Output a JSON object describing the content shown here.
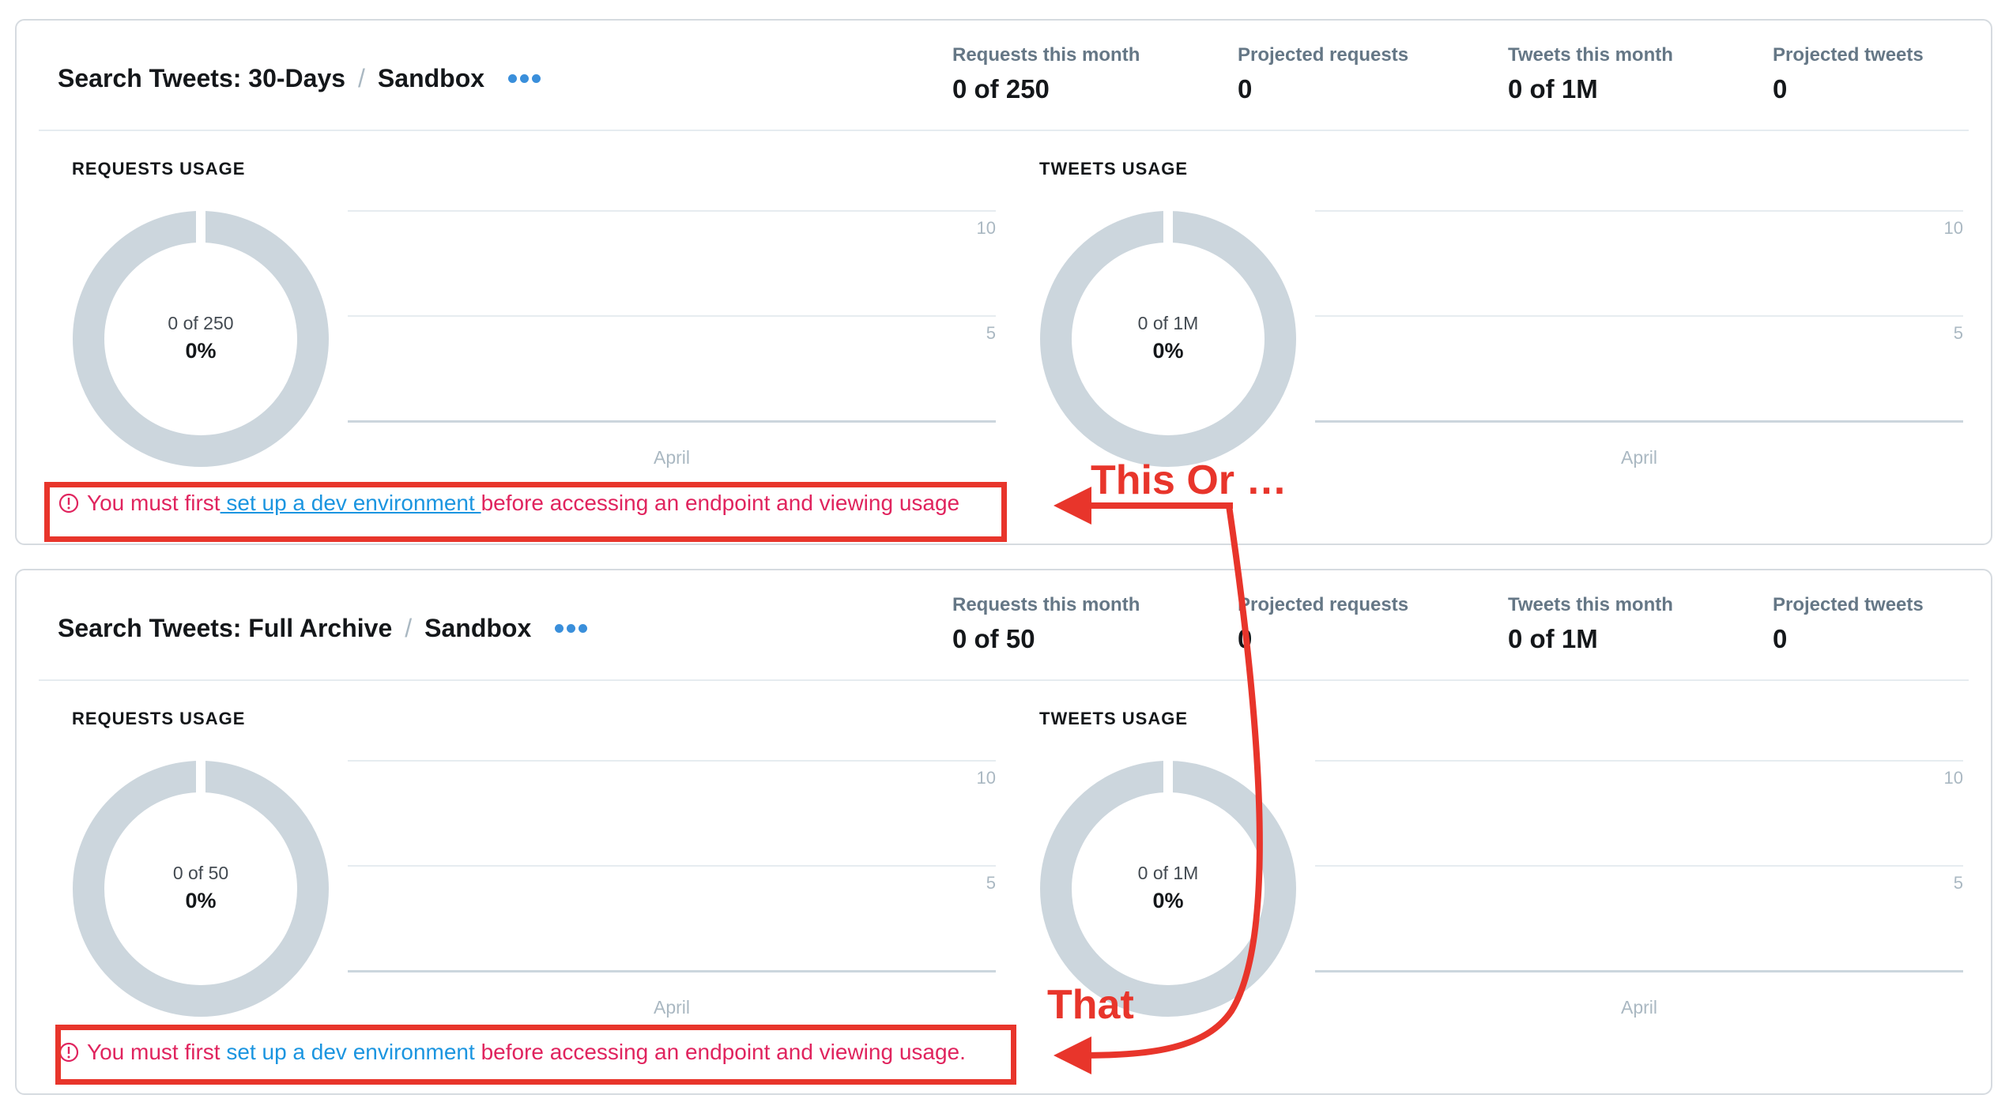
{
  "cards": [
    {
      "title": "Search Tweets: 30-Days",
      "sep": "/",
      "env": "Sandbox",
      "stats": [
        {
          "label": "Requests this month",
          "value": "0 of 250"
        },
        {
          "label": "Projected requests",
          "value": "0"
        },
        {
          "label": "Tweets this month",
          "value": "0 of 1M"
        },
        {
          "label": "Projected tweets",
          "value": "0"
        }
      ],
      "requests_usage": {
        "label": "REQUESTS USAGE",
        "fraction": "0 of 250",
        "percent": "0%",
        "ticks": [
          "10",
          "5"
        ],
        "month": "April"
      },
      "tweets_usage": {
        "label": "TWEETS USAGE",
        "fraction": "0 of 1M",
        "percent": "0%",
        "ticks": [
          "10",
          "5"
        ],
        "month": "April"
      },
      "warning": {
        "prefix": "You must first",
        "link": " set up a dev environment ",
        "suffix": "before accessing an endpoint and viewing usage"
      }
    },
    {
      "title": "Search Tweets: Full Archive",
      "sep": "/",
      "env": "Sandbox",
      "stats": [
        {
          "label": "Requests this month",
          "value": "0 of 50"
        },
        {
          "label": "Projected requests",
          "value": "0"
        },
        {
          "label": "Tweets this month",
          "value": "0 of 1M"
        },
        {
          "label": "Projected tweets",
          "value": "0"
        }
      ],
      "requests_usage": {
        "label": "REQUESTS USAGE",
        "fraction": "0 of 50",
        "percent": "0%",
        "ticks": [
          "10",
          "5"
        ],
        "month": "April"
      },
      "tweets_usage": {
        "label": "TWEETS USAGE",
        "fraction": "0 of 1M",
        "percent": "0%",
        "ticks": [
          "10",
          "5"
        ],
        "month": "April"
      },
      "warning": {
        "prefix": "You must first ",
        "link": "set up a dev environment",
        "suffix": " before accessing an endpoint and viewing usage."
      }
    }
  ],
  "annotations": {
    "this_or": "This Or …",
    "that": "That",
    "color": "#e8352b"
  },
  "colors": {
    "accent": "#1b95e0",
    "warning": "#e0245e",
    "donut_track": "#ccd6dd"
  },
  "icons": [
    "more-dots-icon",
    "alert-circle-icon"
  ]
}
